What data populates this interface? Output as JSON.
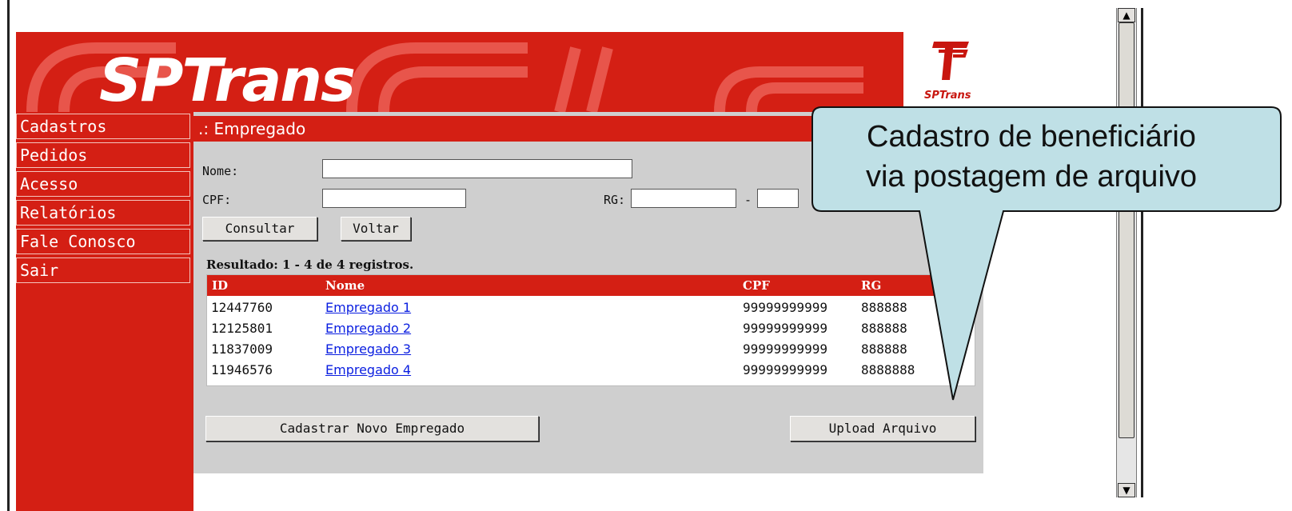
{
  "brand": {
    "name": "SPTrans",
    "logo_caption": "SPTrans"
  },
  "sidebar": {
    "items": [
      {
        "label": "Cadastros"
      },
      {
        "label": "Pedidos"
      },
      {
        "label": "Acesso"
      },
      {
        "label": "Relatórios"
      },
      {
        "label": "Fale Conosco"
      },
      {
        "label": "Sair"
      }
    ]
  },
  "page": {
    "title": ".: Empregado"
  },
  "search": {
    "nome_label": "Nome:",
    "nome_value": "",
    "cpf_label": "CPF:",
    "cpf_value": "",
    "rg_label": "RG:",
    "rg_value": "",
    "rg_sep": "-",
    "rg_digit_value": "",
    "consultar_label": "Consultar",
    "voltar_label": "Voltar"
  },
  "results": {
    "summary": "Resultado: 1 - 4 de 4 registros.",
    "columns": [
      "ID",
      "Nome",
      "CPF",
      "RG"
    ],
    "rows": [
      {
        "id": "12447760",
        "nome": "Empregado 1",
        "cpf": "99999999999",
        "rg": "888888"
      },
      {
        "id": "12125801",
        "nome": "Empregado 2",
        "cpf": "99999999999",
        "rg": "888888"
      },
      {
        "id": "11837009",
        "nome": "Empregado 3",
        "cpf": "99999999999",
        "rg": "888888"
      },
      {
        "id": "11946576",
        "nome": "Empregado 4",
        "cpf": "99999999999",
        "rg": "8888888"
      }
    ]
  },
  "actions": {
    "cadastrar_label": "Cadastrar Novo Empregado",
    "upload_label": "Upload Arquivo"
  },
  "callout": {
    "line1": "Cadastro de beneficiário",
    "line2": "via postagem de arquivo"
  },
  "colors": {
    "brand_red": "#d41f14",
    "panel_gray": "#cfcfcf",
    "link_blue": "#0a1ee0",
    "callout_fill": "#bfe0e6"
  },
  "icons": {
    "scroll_up": "scroll-up-arrow-icon",
    "scroll_down": "scroll-down-arrow-icon"
  }
}
